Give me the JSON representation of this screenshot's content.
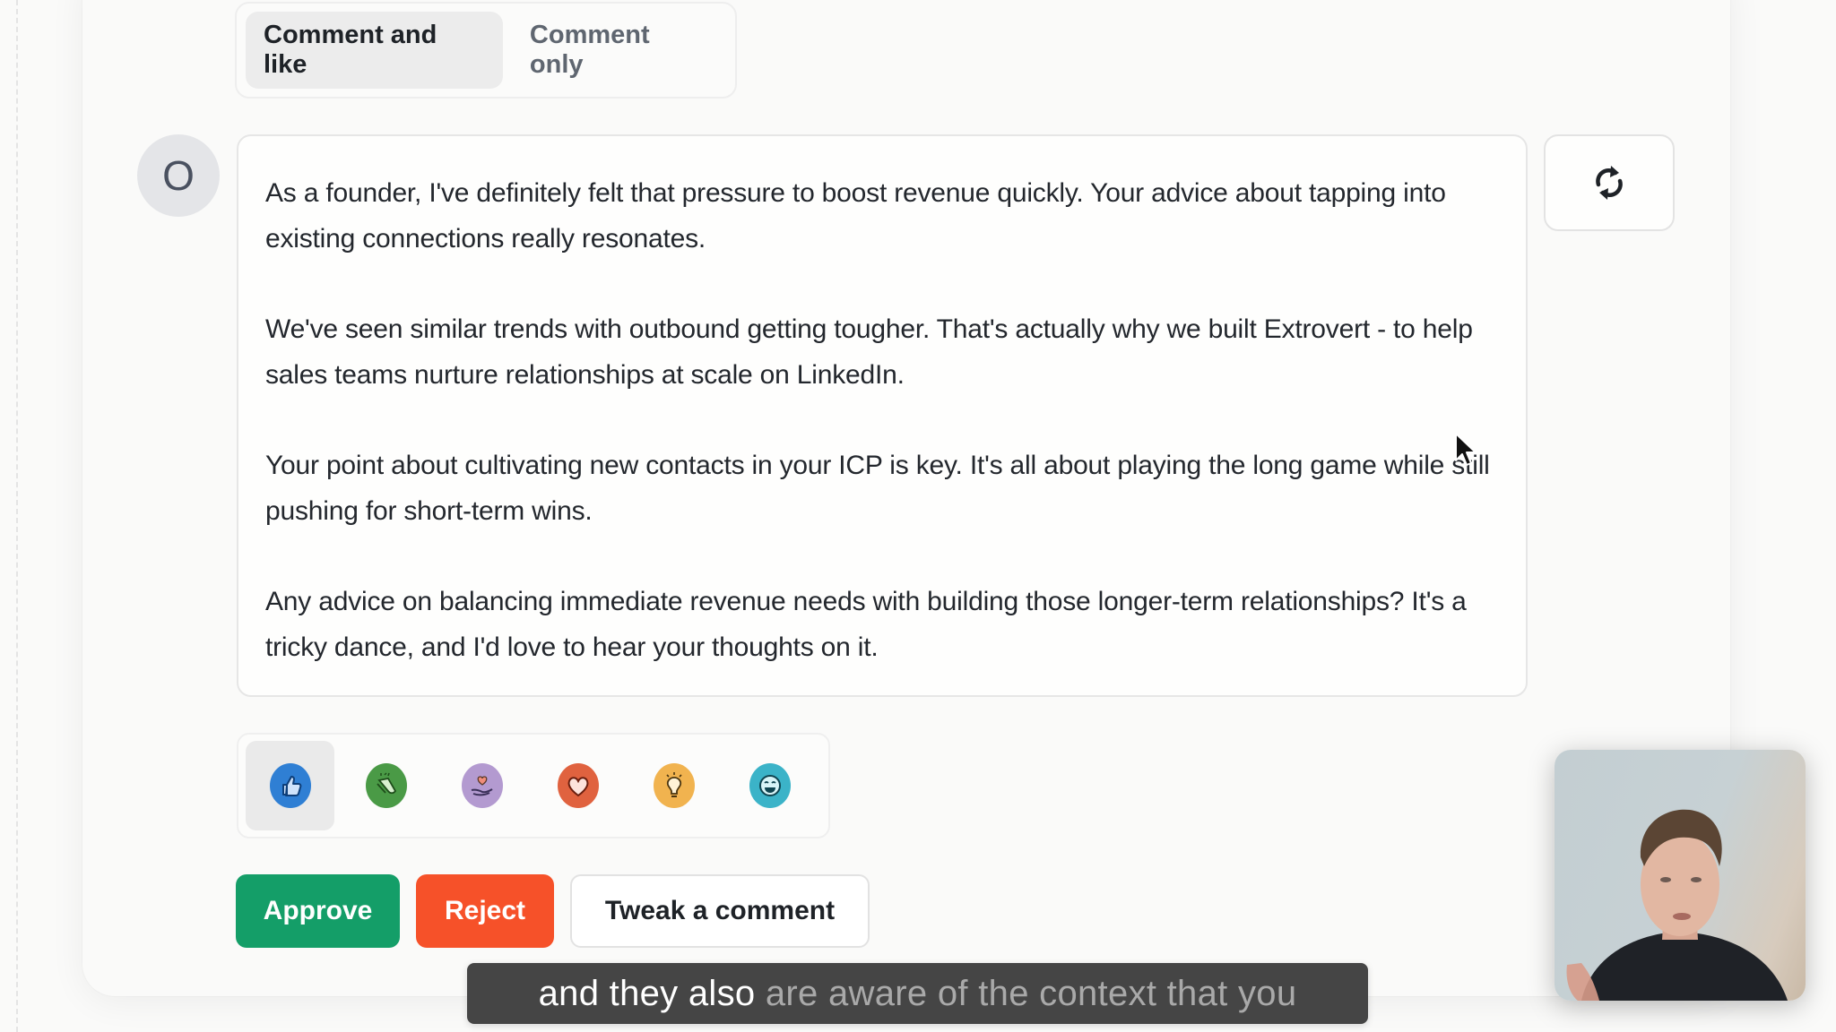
{
  "mode_toggle": {
    "tabs": [
      {
        "label": "Comment and like",
        "active": true
      },
      {
        "label": "Comment only",
        "active": false
      }
    ]
  },
  "comment": {
    "author_initial": "O",
    "paragraphs": [
      "As a founder, I've definitely felt that pressure to boost revenue quickly. Your advice about tapping into existing connections really resonates.",
      "We've seen similar trends with outbound getting tougher. That's actually why we built Extrovert - to help sales teams nurture relationships at scale on LinkedIn.",
      "Your point about cultivating new contacts in your ICP is key. It's all about playing the long game while still pushing for short-term wins.",
      "Any advice on balancing immediate revenue needs with building those longer-term relationships? It's a tricky dance, and I'd love to hear your thoughts on it."
    ],
    "regenerate_icon": "refresh-icon"
  },
  "reactions": {
    "selected": "like",
    "items": [
      {
        "id": "like",
        "icon": "thumbs-up-icon",
        "color": "#2f7fd4"
      },
      {
        "id": "celebrate",
        "icon": "clapping-hands-icon",
        "color": "#4a9a46"
      },
      {
        "id": "support",
        "icon": "heart-in-hand-icon",
        "color": "#b39ad0"
      },
      {
        "id": "love",
        "icon": "heart-icon",
        "color": "#e0623f"
      },
      {
        "id": "insightful",
        "icon": "lightbulb-icon",
        "color": "#f1b34f"
      },
      {
        "id": "funny",
        "icon": "laughing-face-icon",
        "color": "#3bb3c8"
      }
    ]
  },
  "actions": {
    "approve_label": "Approve",
    "reject_label": "Reject",
    "tweak_label": "Tweak a comment",
    "approve_color": "#149e68",
    "reject_color": "#f65129"
  },
  "caption": {
    "spoken": "and they also",
    "upcoming": "are aware of the context that you"
  }
}
